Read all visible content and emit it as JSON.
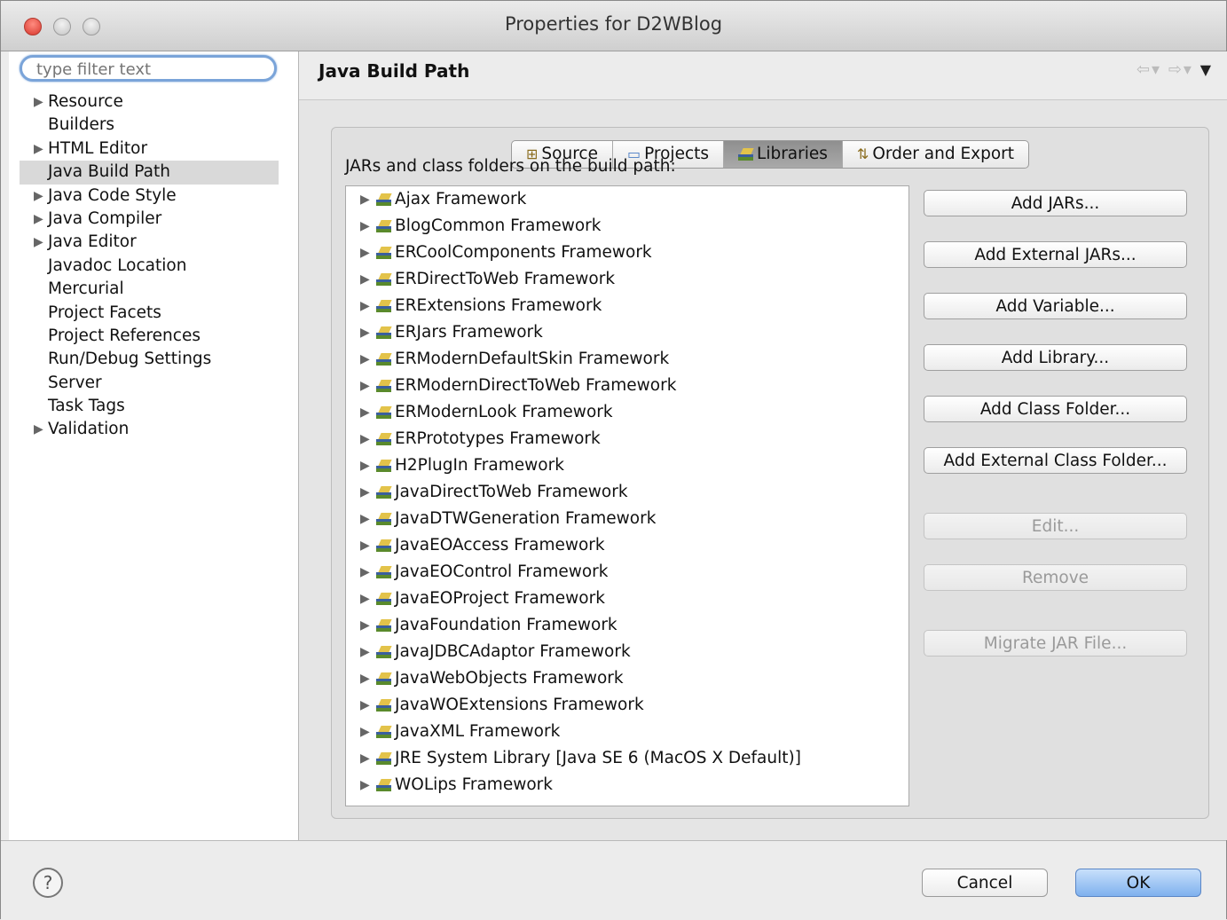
{
  "window": {
    "title": "Properties for D2WBlog"
  },
  "sidebar": {
    "filter_placeholder": "type filter text",
    "items": [
      {
        "label": "Resource",
        "expandable": true
      },
      {
        "label": "Builders",
        "expandable": false
      },
      {
        "label": "HTML Editor",
        "expandable": true
      },
      {
        "label": "Java Build Path",
        "expandable": false,
        "selected": true
      },
      {
        "label": "Java Code Style",
        "expandable": true
      },
      {
        "label": "Java Compiler",
        "expandable": true
      },
      {
        "label": "Java Editor",
        "expandable": true
      },
      {
        "label": "Javadoc Location",
        "expandable": false
      },
      {
        "label": "Mercurial",
        "expandable": false
      },
      {
        "label": "Project Facets",
        "expandable": false
      },
      {
        "label": "Project References",
        "expandable": false
      },
      {
        "label": "Run/Debug Settings",
        "expandable": false
      },
      {
        "label": "Server",
        "expandable": false
      },
      {
        "label": "Task Tags",
        "expandable": false
      },
      {
        "label": "Validation",
        "expandable": true
      }
    ]
  },
  "main": {
    "title": "Java Build Path",
    "tabs": [
      {
        "label": "Source",
        "icon": "source-folder-icon"
      },
      {
        "label": "Projects",
        "icon": "projects-folder-icon"
      },
      {
        "label": "Libraries",
        "icon": "library-icon",
        "active": true
      },
      {
        "label": "Order and Export",
        "icon": "order-export-icon"
      }
    ],
    "list_label": "JARs and class folders on the build path:",
    "libraries": [
      "Ajax Framework",
      "BlogCommon Framework",
      "ERCoolComponents Framework",
      "ERDirectToWeb Framework",
      "ERExtensions Framework",
      "ERJars Framework",
      "ERModernDefaultSkin Framework",
      "ERModernDirectToWeb Framework",
      "ERModernLook Framework",
      "ERPrototypes Framework",
      "H2PlugIn Framework",
      "JavaDirectToWeb Framework",
      "JavaDTWGeneration Framework",
      "JavaEOAccess Framework",
      "JavaEOControl Framework",
      "JavaEOProject Framework",
      "JavaFoundation Framework",
      "JavaJDBCAdaptor Framework",
      "JavaWebObjects Framework",
      "JavaWOExtensions Framework",
      "JavaXML Framework",
      "JRE System Library [Java SE 6 (MacOS X Default)]",
      "WOLips Framework"
    ],
    "buttons": {
      "add_jars": "Add JARs...",
      "add_external_jars": "Add External JARs...",
      "add_variable": "Add Variable...",
      "add_library": "Add Library...",
      "add_class_folder": "Add Class Folder...",
      "add_external_class_folder": "Add External Class Folder...",
      "edit": "Edit...",
      "remove": "Remove",
      "migrate_jar": "Migrate JAR File..."
    }
  },
  "footer": {
    "help": "?",
    "cancel": "Cancel",
    "ok": "OK"
  }
}
